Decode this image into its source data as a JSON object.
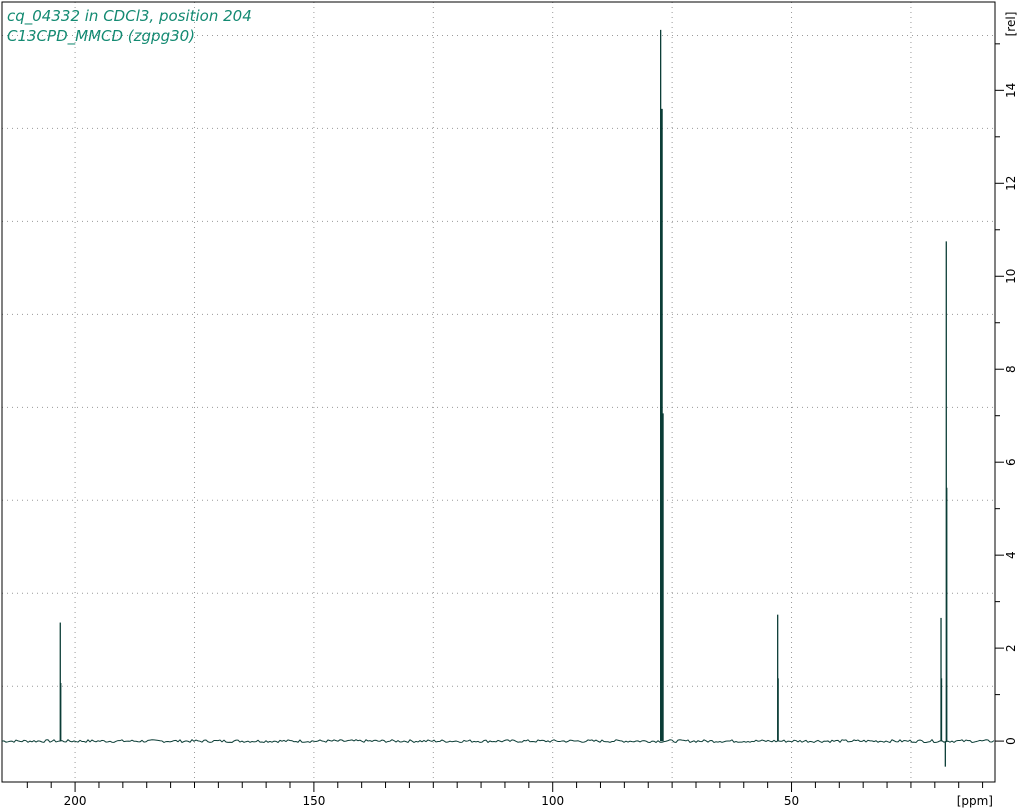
{
  "title_lines": [
    "cq_04332 in CDCl3, position 204",
    "C13CPD_MMCD (zgpg30)"
  ],
  "colors": {
    "spectrum": "#0b3d36",
    "title": "#138a72",
    "grid": "#9a9a9a",
    "frame": "#000000"
  },
  "chart_data": {
    "type": "line",
    "xlabel": "[ppm]",
    "ylabel": "[rel]",
    "x_reversed": true,
    "xlim": [
      215.3,
      7.4
    ],
    "ylim": [
      -0.88,
      15.9
    ],
    "x_ticks": [
      200,
      150,
      100,
      50
    ],
    "y_ticks": [
      0,
      2,
      4,
      6,
      8,
      10,
      12,
      14
    ],
    "grid": true,
    "peaks": [
      {
        "ppm": 203.1,
        "height": 2.55
      },
      {
        "ppm": 203.0,
        "height": 1.25
      },
      {
        "ppm": 77.4,
        "height": 15.3
      },
      {
        "ppm": 77.3,
        "height": 13.6
      },
      {
        "ppm": 77.1,
        "height": 13.6
      },
      {
        "ppm": 76.9,
        "height": 7.05
      },
      {
        "ppm": 52.9,
        "height": 2.72
      },
      {
        "ppm": 52.8,
        "height": 1.35
      },
      {
        "ppm": 18.7,
        "height": 2.65
      },
      {
        "ppm": 18.6,
        "height": 1.35
      },
      {
        "ppm": 17.6,
        "height": 10.75
      },
      {
        "ppm": 17.5,
        "height": 5.45
      },
      {
        "ppm": 17.8,
        "height": -0.55
      }
    ]
  }
}
